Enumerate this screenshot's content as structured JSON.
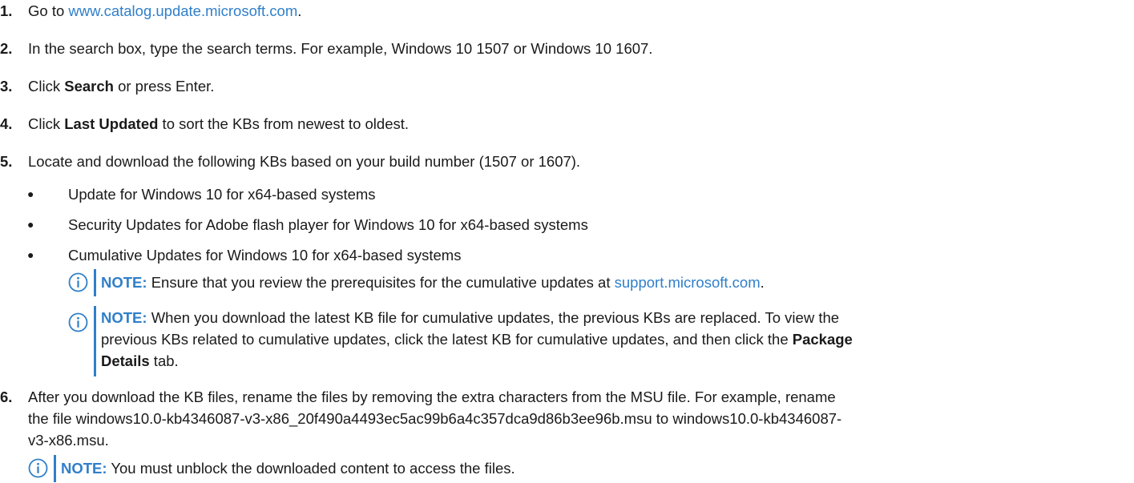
{
  "accent": "#2f7fc9",
  "steps": [
    {
      "num": "1.",
      "prefix": "Go to ",
      "link": "www.catalog.update.microsoft.com",
      "suffix": "."
    },
    {
      "num": "2.",
      "text": "In the search box, type the search terms. For example, Windows 10 1507 or Windows 10 1607."
    },
    {
      "num": "3.",
      "pre": "Click ",
      "bold": "Search",
      "post": " or press Enter."
    },
    {
      "num": "4.",
      "pre": "Click ",
      "bold": "Last Updated",
      "post": " to sort the KBs from newest to oldest."
    },
    {
      "num": "5.",
      "text": "Locate and download the following KBs based on your build number (1507 or 1607)."
    },
    {
      "num": "6.",
      "text_line1": "After you download the KB files, rename the files by removing the extra characters from the MSU file. For example, rename",
      "text_line2": "the file windows10.0-kb4346087-v3-x86_20f490a4493ec5ac99b6a4c357dca9d86b3ee96b.msu to windows10.0-kb4346087-",
      "text_line3": "v3-x86.msu."
    }
  ],
  "bullets": [
    "Update for Windows 10 for x64-based systems",
    "Security Updates for Adobe flash player for Windows 10 for x64-based systems",
    "Cumulative Updates for Windows 10 for x64-based systems"
  ],
  "bullet_glyph": "●",
  "notes": [
    {
      "icon": "info-circle-icon",
      "label": "NOTE:",
      "text": " Ensure that you review the prerequisites for the cumulative updates at ",
      "link": "support.microsoft.com",
      "suffix": "."
    },
    {
      "icon": "info-circle-icon",
      "label": "NOTE:",
      "line1": " When you download the latest KB file for cumulative updates, the previous KBs are replaced. To view the",
      "line2": "previous KBs related to cumulative updates, click the latest KB for cumulative updates, and then click the ",
      "bold": "Package",
      "line3_bold": "Details",
      "line3_post": " tab."
    },
    {
      "icon": "info-circle-icon",
      "label": "NOTE:",
      "text": " You must unblock the downloaded content to access the files."
    }
  ]
}
